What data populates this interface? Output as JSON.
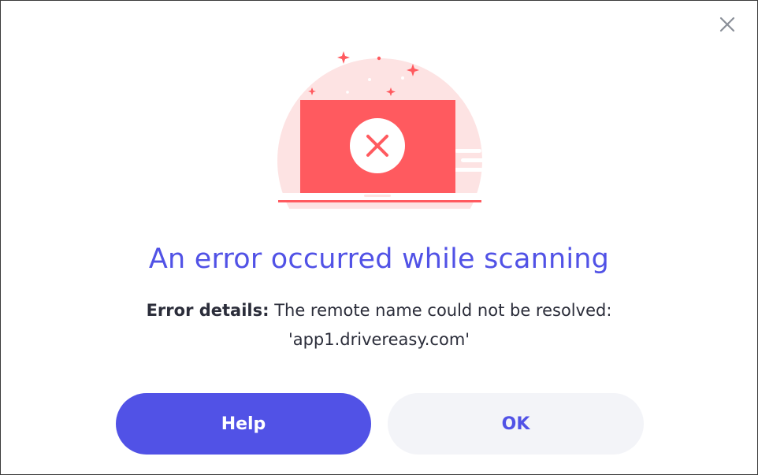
{
  "dialog": {
    "close_icon": "close-icon",
    "illustration_icon": "laptop-error-icon",
    "title": "An error occurred while scanning",
    "details_label": "Error details:",
    "details_text": "The remote name could not be resolved:",
    "details_host": "'app1.drivereasy.com'",
    "help_label": "Help",
    "ok_label": "OK"
  },
  "colors": {
    "accent": "#5152e6",
    "error_red": "#ff5a5f",
    "pink_bg": "#fde3e3",
    "secondary_button": "#f3f4f8"
  }
}
